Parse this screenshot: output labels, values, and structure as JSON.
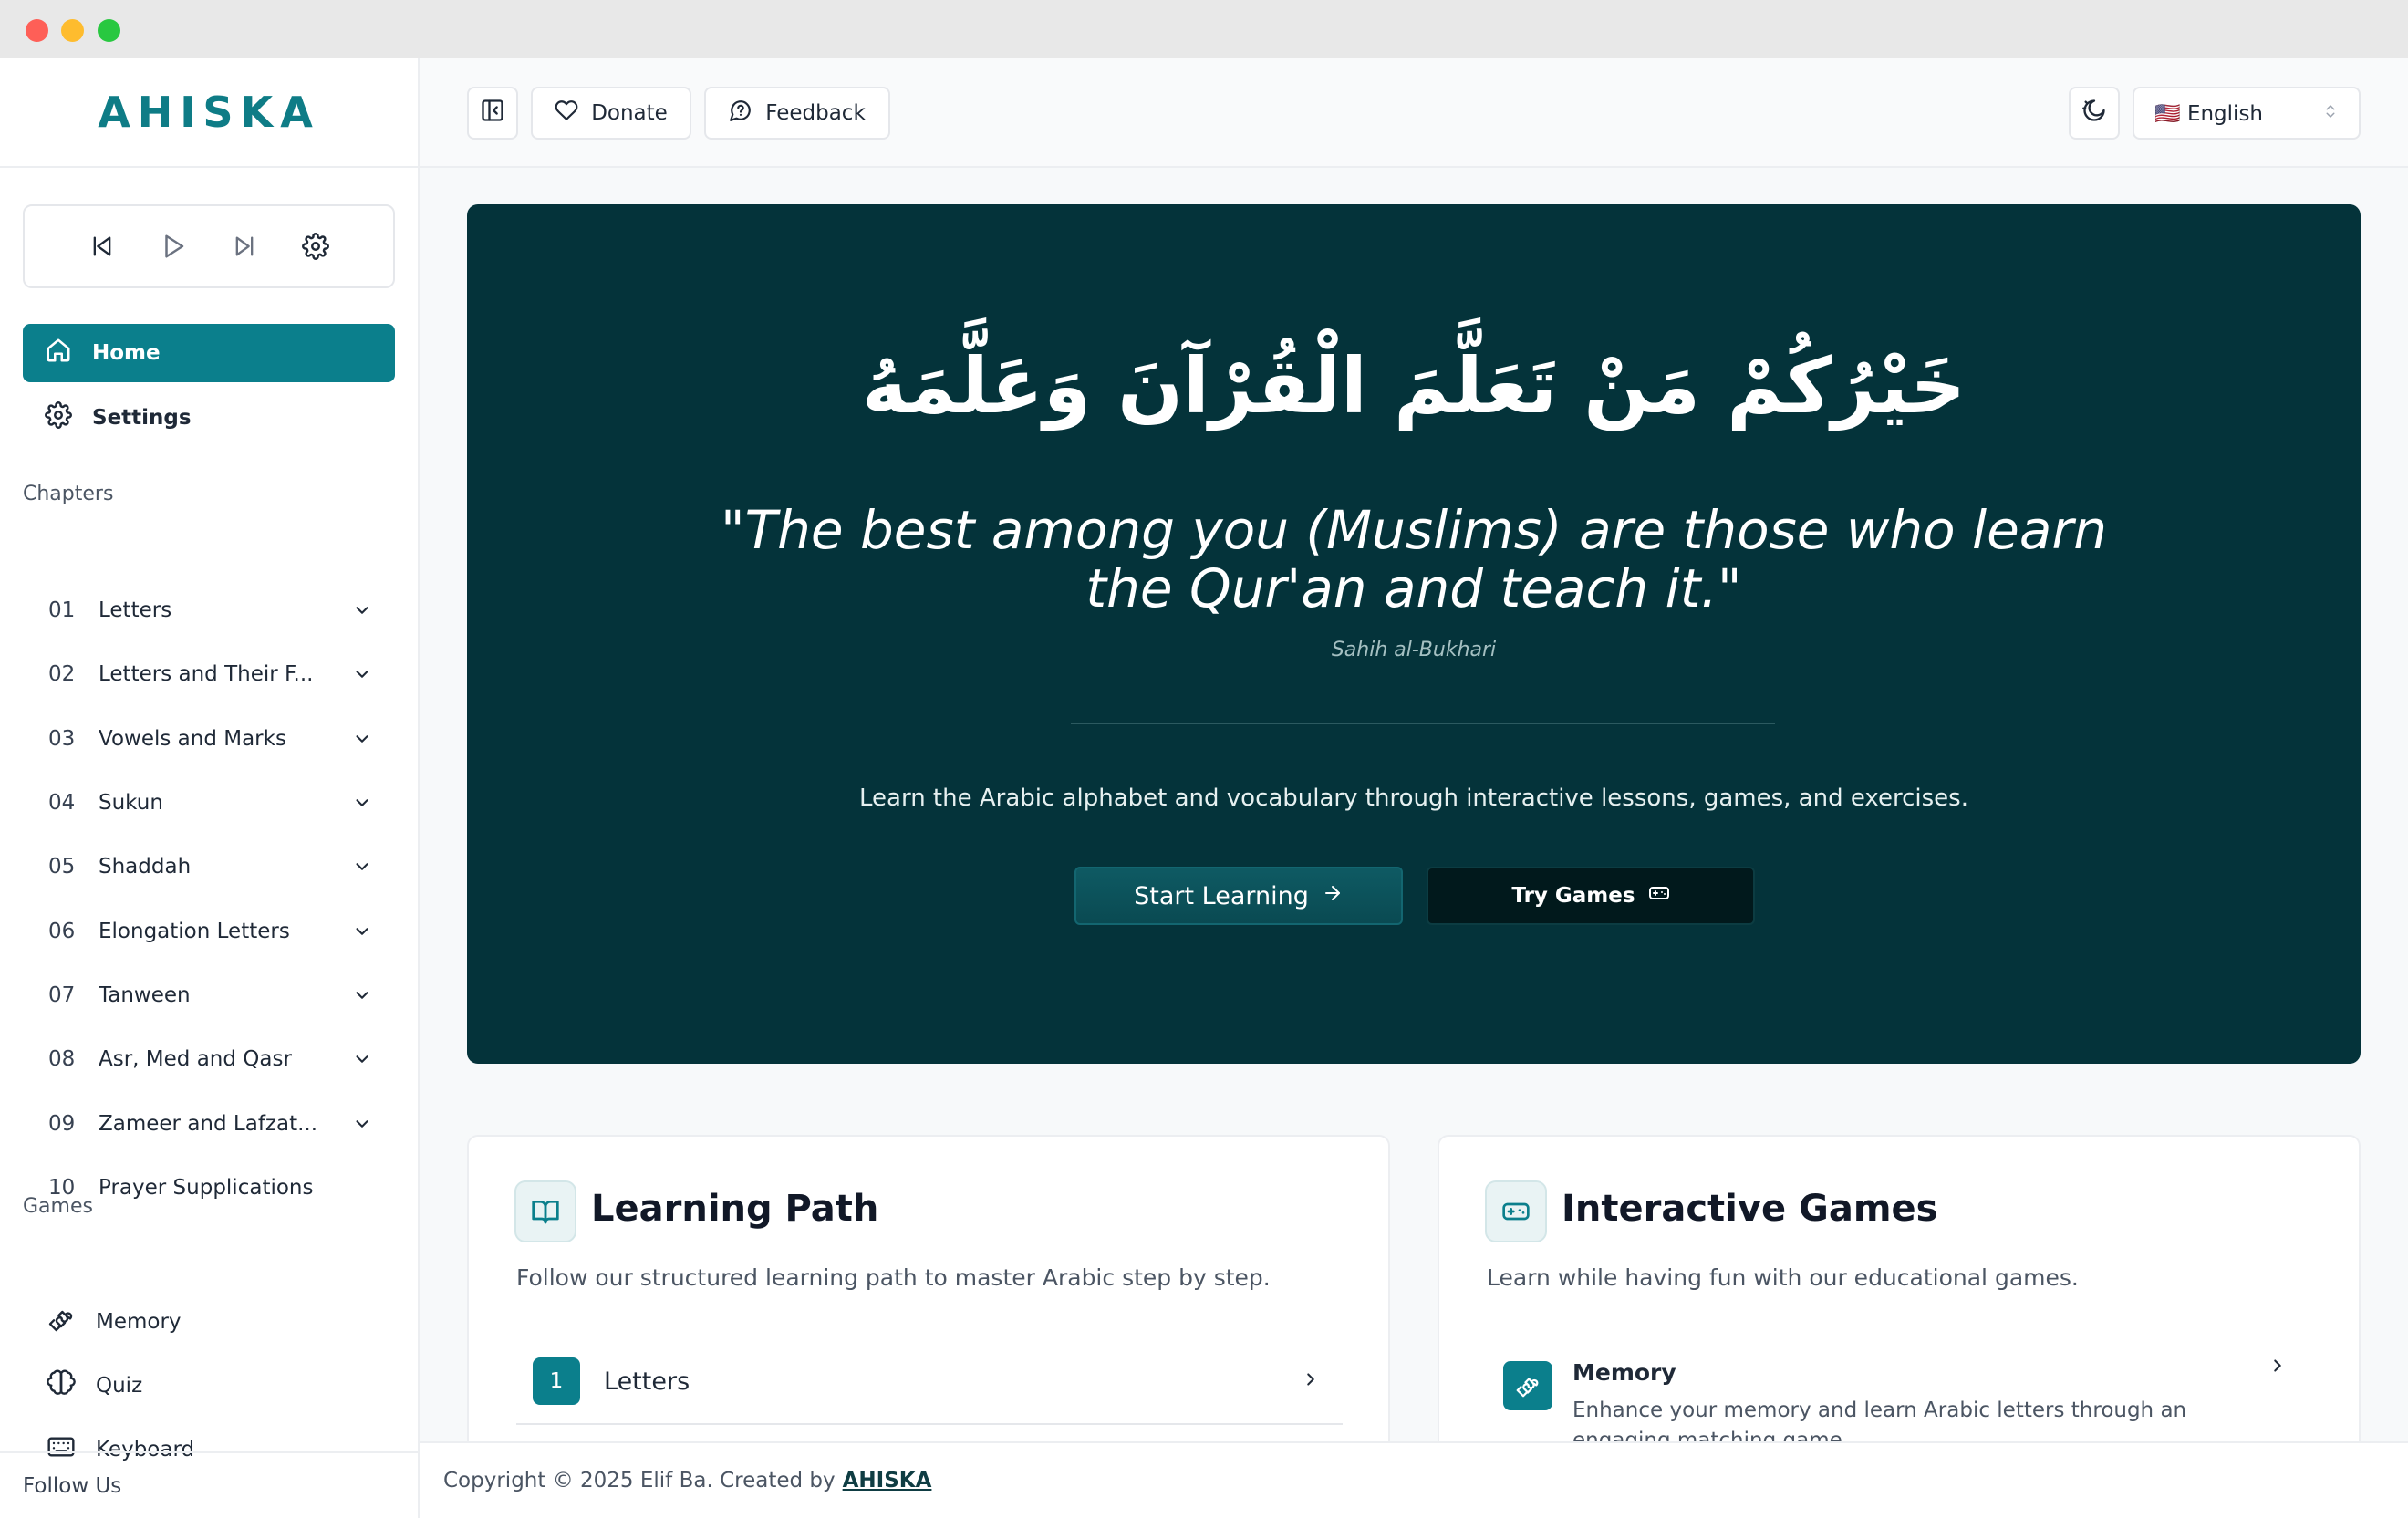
{
  "brand": {
    "logo": "AHISKA"
  },
  "player": {
    "icons": [
      "skip-back-icon",
      "play-icon",
      "skip-forward-icon",
      "settings-icon"
    ]
  },
  "nav": [
    {
      "label": "Home",
      "icon": "home-icon",
      "active": true
    },
    {
      "label": "Settings",
      "icon": "gear-icon",
      "active": false
    }
  ],
  "chapters_label": "Chapters",
  "chapters": [
    {
      "num": "01",
      "title": "Letters"
    },
    {
      "num": "02",
      "title": "Letters and Their F..."
    },
    {
      "num": "03",
      "title": "Vowels and Marks"
    },
    {
      "num": "04",
      "title": "Sukun"
    },
    {
      "num": "05",
      "title": "Shaddah"
    },
    {
      "num": "06",
      "title": "Elongation Letters"
    },
    {
      "num": "07",
      "title": "Tanween"
    },
    {
      "num": "08",
      "title": "Asr, Med and Qasr"
    },
    {
      "num": "09",
      "title": "Zameer and Lafzat..."
    },
    {
      "num": "10",
      "title": "Prayer Supplications"
    }
  ],
  "games_label": "Games",
  "games": [
    {
      "label": "Memory",
      "icon": "puzzle-icon"
    },
    {
      "label": "Quiz",
      "icon": "brain-icon"
    },
    {
      "label": "Keyboard",
      "icon": "keyboard-icon"
    }
  ],
  "follow_label": "Follow Us",
  "topbar": {
    "donate": "Donate",
    "feedback": "Feedback",
    "language": "🇺🇸 English"
  },
  "hero": {
    "arabic": "خَيْرُكُمْ مَنْ تَعَلَّمَ الْقُرْآنَ وَعَلَّمَهُ",
    "quote_line1": "\"The best among you (Muslims) are those who learn",
    "quote_line2": "the Qur'an and teach it.\"",
    "source": "Sahih al-Bukhari",
    "subtext": "Learn the Arabic alphabet and vocabulary through interactive lessons, games, and exercises.",
    "start_button": "Start Learning",
    "games_button": "Try Games"
  },
  "learning_path": {
    "title": "Learning Path",
    "desc": "Follow our structured learning path to master Arabic step by step.",
    "first_step_num": "1",
    "first_step_label": "Letters"
  },
  "interactive_games": {
    "title": "Interactive Games",
    "desc": "Learn while having fun with our educational games.",
    "first_game_name": "Memory",
    "first_game_desc": "Enhance your memory and learn Arabic letters through an engaging matching game."
  },
  "footer": {
    "text": "Copyright © 2025 Elif Ba. Created by",
    "link": "AHISKA"
  },
  "colors": {
    "accent": "#0b7f8c",
    "hero_bg": "#04333a"
  }
}
